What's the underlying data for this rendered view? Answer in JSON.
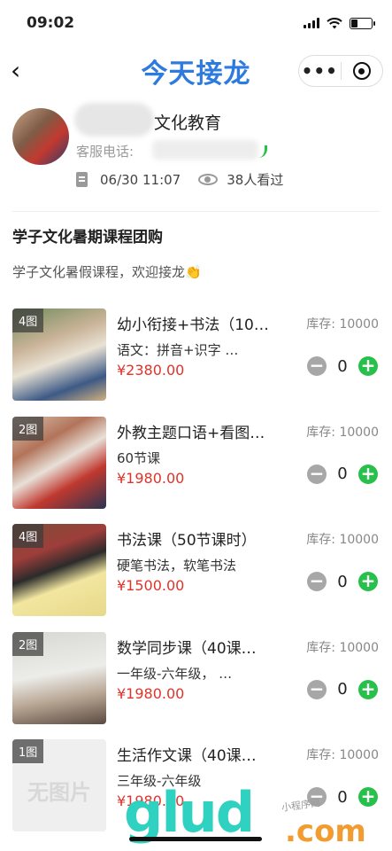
{
  "status_bar": {
    "time": "09:02"
  },
  "nav": {
    "back_icon": "‹",
    "title": "今天接龙",
    "more_label": "•••"
  },
  "org": {
    "name": "文化教育",
    "phone_label": "客服电话:"
  },
  "meta": {
    "datetime": "06/30 11:07",
    "views": "38人看过"
  },
  "campaign": {
    "title": "学子文化暑期课程团购",
    "description": "学子文化暑假课程，欢迎接龙👏"
  },
  "products": [
    {
      "badge": "4图",
      "name": "幼小衔接+书法（10…",
      "desc": "语文：拼音+识字 …",
      "price": "¥2380.00",
      "stock": "库存: 10000",
      "qty": "0",
      "thumb_bg": "linear-gradient(160deg,#6f8b5a 0%,#c9b398 35%,#e9e2d4 55%,#3d5a86 80%,#d2b07d 100%)"
    },
    {
      "badge": "2图",
      "name": "外教主题口语+看图…",
      "desc": "60节课",
      "price": "¥1980.00",
      "stock": "库存: 10000",
      "qty": "0",
      "thumb_bg": "linear-gradient(150deg,#d9c3b0 0%,#b2745a 30%,#e8e0d8 50%,#c0392f 70%,#2a3550 100%)"
    },
    {
      "badge": "4图",
      "name": "书法课（50节课时）",
      "desc": "硬笔书法，软笔书法",
      "price": "¥1500.00",
      "stock": "库存: 10000",
      "qty": "0",
      "thumb_bg": "linear-gradient(160deg,#7c4f36 0%,#9e3e3a 30%,#2b2b2b 48%,#f2e6a0 65%,#e7d98a 100%)"
    },
    {
      "badge": "2图",
      "name": "数学同步课（40课…",
      "desc": "一年级-六年级， …",
      "price": "¥1980.00",
      "stock": "库存: 10000",
      "qty": "0",
      "thumb_bg": "linear-gradient(170deg,#d7d7d2 0%,#ecece9 45%,#b9a795 70%,#5a4a40 100%)"
    },
    {
      "badge": "1图",
      "name": "生活作文课（40课…",
      "desc": "三年级-六年级",
      "price": "¥1980.00",
      "stock": "库存: 10000",
      "qty": "0",
      "noimg": "无图片",
      "thumb_bg": "#efefef"
    }
  ],
  "watermark": {
    "brand": "glud",
    "suffix": ".com",
    "small": "小程序网"
  }
}
